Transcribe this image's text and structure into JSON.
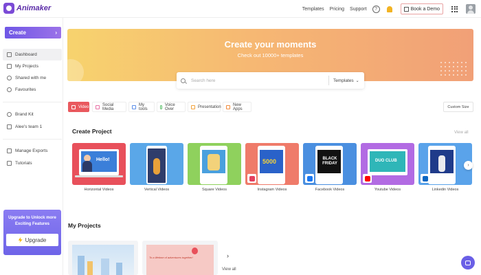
{
  "brand": {
    "name": "Animaker"
  },
  "topbar": {
    "links": [
      "Templates",
      "Pricing",
      "Support"
    ],
    "book_demo": "Book a Demo"
  },
  "sidebar": {
    "create_label": "Create",
    "items": [
      "Dashboard",
      "My Projects",
      "Shared with me",
      "Favourites"
    ],
    "items2": [
      "Brand Kit",
      "Alee's team 1"
    ],
    "items3": [
      "Manage Exports",
      "Tutorials"
    ],
    "upgrade": {
      "text": "Upgrade to Unlock more Exciting Features",
      "button": "Upgrade"
    }
  },
  "hero": {
    "title": "Create your moments",
    "subtitle": "Check out 10000+ templates",
    "search_placeholder": "Search here",
    "search_filter": "Templates"
  },
  "categories": {
    "tabs": [
      "Video",
      "Social Media",
      "My tools",
      "Voice Over",
      "Presentation",
      "New Apps"
    ],
    "custom_size": "Custom Size"
  },
  "create_project": {
    "title": "Create Project",
    "view_all": "View all",
    "cards": [
      {
        "label": "Horizontal Videos",
        "bg": "#e8505b",
        "screen_text": "Hello!"
      },
      {
        "label": "Vertical Videos",
        "bg": "#5aa7e8"
      },
      {
        "label": "Square Videos",
        "bg": "#8fd15d"
      },
      {
        "label": "Instagram Videos",
        "bg": "#ef7b6a",
        "screen_text": "5000"
      },
      {
        "label": "Facebook Videos",
        "bg": "#4a8fe0",
        "screen_text": "BLACK FRIDAY"
      },
      {
        "label": "Youtube Videos",
        "bg": "#b26be3",
        "screen_text": "DUO CLUB"
      },
      {
        "label": "Linkedin Videos",
        "bg": "#5aa3ea"
      }
    ]
  },
  "my_projects": {
    "title": "My Projects",
    "view_all": "View all",
    "project2_text": "To a lifetime of adventures together!"
  },
  "colors": {
    "accent": "#7b5ce8",
    "active_tab": "#e9595e"
  }
}
